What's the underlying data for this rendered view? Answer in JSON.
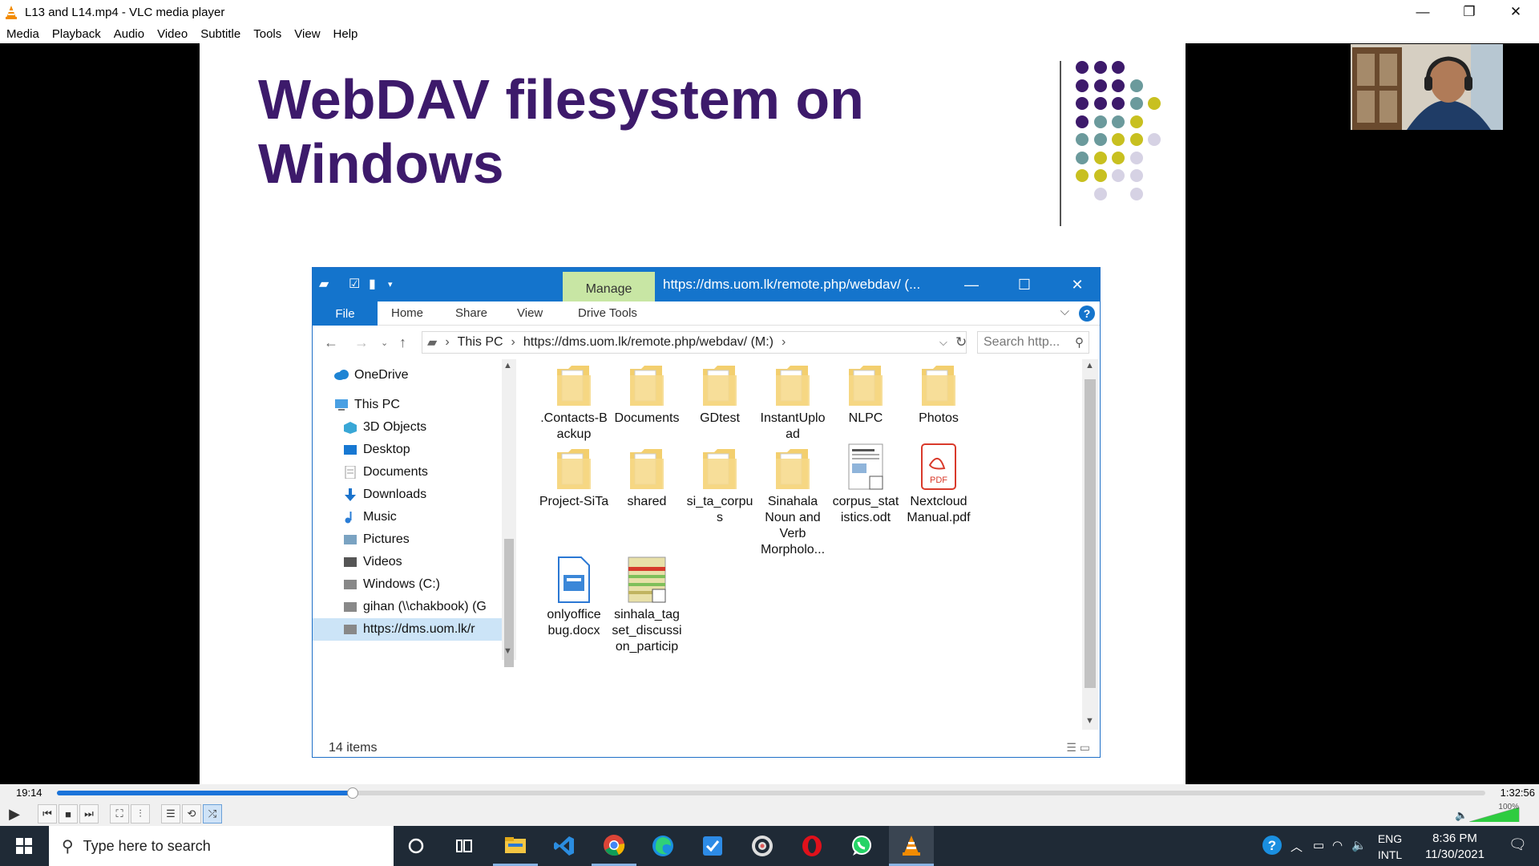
{
  "window": {
    "title": "L13 and L14.mp4 - VLC media player",
    "controls": {
      "minimize": "—",
      "restore": "❐",
      "close": "✕"
    }
  },
  "menu": [
    "Media",
    "Playback",
    "Audio",
    "Video",
    "Subtitle",
    "Tools",
    "View",
    "Help"
  ],
  "slide": {
    "title_line1": "WebDAV filesystem on",
    "title_line2": "Windows",
    "colors": {
      "title": "#3d1a6b",
      "purple": "#3d1a6b",
      "teal": "#6b9a9c",
      "olive": "#c8c020",
      "lavender": "#d6d2e4"
    }
  },
  "explorer": {
    "manage_tab": "Manage",
    "title_path": "https://dms.uom.lk/remote.php/webdav/ (...",
    "ribbon_tabs": [
      "File",
      "Home",
      "Share",
      "View",
      "Drive Tools"
    ],
    "address": {
      "segments": [
        "This PC",
        "https://dms.uom.lk/remote.php/webdav/ (M:)"
      ]
    },
    "search_placeholder": "Search http...",
    "nav_items": [
      {
        "label": "OneDrive",
        "icon": "onedrive-icon"
      },
      {
        "label": "This PC",
        "icon": "computer-icon"
      },
      {
        "label": "3D Objects",
        "icon": "cube-icon"
      },
      {
        "label": "Desktop",
        "icon": "desktop-icon"
      },
      {
        "label": "Documents",
        "icon": "document-icon"
      },
      {
        "label": "Downloads",
        "icon": "download-icon"
      },
      {
        "label": "Music",
        "icon": "music-icon"
      },
      {
        "label": "Pictures",
        "icon": "pictures-icon"
      },
      {
        "label": "Videos",
        "icon": "videos-icon"
      },
      {
        "label": "Windows (C:)",
        "icon": "drive-icon"
      },
      {
        "label": "gihan (\\\\chakbook) (G",
        "icon": "network-drive-icon"
      },
      {
        "label": "https://dms.uom.lk/r",
        "icon": "network-drive-icon"
      }
    ],
    "files": [
      {
        "name": ".Contacts-B\nackup",
        "type": "folder"
      },
      {
        "name": "Documents",
        "type": "folder"
      },
      {
        "name": "GDtest",
        "type": "folder"
      },
      {
        "name": "InstantUplo\nad",
        "type": "folder"
      },
      {
        "name": "NLPC",
        "type": "folder"
      },
      {
        "name": "Photos",
        "type": "folder"
      },
      {
        "name": "Project-SiTa",
        "type": "folder"
      },
      {
        "name": "shared",
        "type": "folder"
      },
      {
        "name": "si_ta_corpu\ns",
        "type": "folder"
      },
      {
        "name": "Sinahala\nNoun and\nVerb\nMorpholo...",
        "type": "folder"
      },
      {
        "name": "corpus_stat\nistics.odt",
        "type": "odt"
      },
      {
        "name": "Nextcloud\nManual.pdf",
        "type": "pdf"
      },
      {
        "name": "onlyoffice\nbug.docx",
        "type": "docx"
      },
      {
        "name": "sinhala_tag\nset_discussi\non_particip",
        "type": "sheet"
      }
    ],
    "item_count": "14 items"
  },
  "player": {
    "elapsed": "19:14",
    "total": "1:32:56",
    "progress": 0.2069,
    "volume": "100%"
  },
  "taskbar": {
    "search_placeholder": "Type here to search",
    "lang_line1": "ENG",
    "lang_line2": "INTL",
    "time": "8:36 PM",
    "date": "11/30/2021"
  }
}
